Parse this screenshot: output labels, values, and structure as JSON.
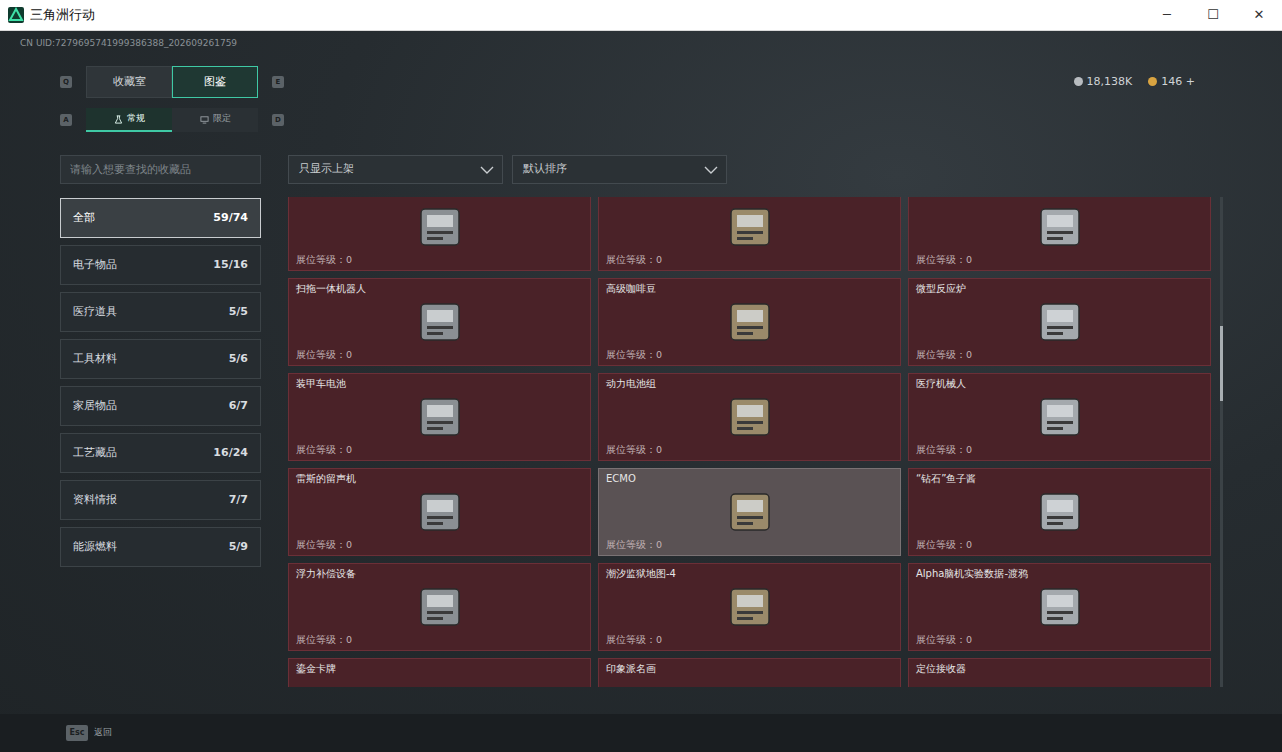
{
  "window": {
    "title": "三角洲行动",
    "controls": [
      "─",
      "☐",
      "✕"
    ]
  },
  "uid": "CN UID:7279695741999386388_202609261759",
  "tab_keys": {
    "left": "Q",
    "right": "E"
  },
  "tabs": [
    {
      "label": "收藏室",
      "selected": false
    },
    {
      "label": "图鉴",
      "selected": true
    }
  ],
  "subtab_keys": {
    "left": "A",
    "right": "D"
  },
  "subtabs": [
    {
      "label": "常规",
      "selected": true
    },
    {
      "label": "限定",
      "selected": false
    }
  ],
  "currencies": [
    {
      "amount": "18,138K",
      "color": "#b8bcc0"
    },
    {
      "amount": "146 +",
      "color": "#d9a441"
    }
  ],
  "search": {
    "placeholder": "请输入想要查找的收藏品"
  },
  "filters": [
    {
      "label": "只显示上架"
    },
    {
      "label": "默认排序"
    }
  ],
  "categories": [
    {
      "label": "全部",
      "count": "59/74",
      "selected": true
    },
    {
      "label": "电子物品",
      "count": "15/16",
      "selected": false
    },
    {
      "label": "医疗道具",
      "count": "5/5",
      "selected": false
    },
    {
      "label": "工具材料",
      "count": "5/6",
      "selected": false
    },
    {
      "label": "家居物品",
      "count": "6/7",
      "selected": false
    },
    {
      "label": "工艺藏品",
      "count": "16/24",
      "selected": false
    },
    {
      "label": "资料情报",
      "count": "7/7",
      "selected": false
    },
    {
      "label": "能源燃料",
      "count": "5/9",
      "selected": false
    }
  ],
  "items": [
    {
      "name": "",
      "rank_text": "展位等级：0",
      "selected": false
    },
    {
      "name": "",
      "rank_text": "展位等级：0",
      "selected": false
    },
    {
      "name": "",
      "rank_text": "展位等级：0",
      "selected": false
    },
    {
      "name": "扫拖一体机器人",
      "rank_text": "展位等级：0",
      "selected": false
    },
    {
      "name": "高级咖啡豆",
      "rank_text": "展位等级：0",
      "selected": false
    },
    {
      "name": "微型反应炉",
      "rank_text": "展位等级：0",
      "selected": false
    },
    {
      "name": "装甲车电池",
      "rank_text": "展位等级：0",
      "selected": false
    },
    {
      "name": "动力电池组",
      "rank_text": "展位等级：0",
      "selected": false
    },
    {
      "name": "医疗机械人",
      "rank_text": "展位等级：0",
      "selected": false
    },
    {
      "name": "雷斯的留声机",
      "rank_text": "展位等级：0",
      "selected": false
    },
    {
      "name": "ECMO",
      "rank_text": "展位等级：0",
      "selected": true
    },
    {
      "name": "“钻石”鱼子酱",
      "rank_text": "展位等级：0",
      "selected": false
    },
    {
      "name": "浮力补偿设备",
      "rank_text": "展位等级：0",
      "selected": false
    },
    {
      "name": "潮汐监狱地图-4",
      "rank_text": "展位等级：0",
      "selected": false
    },
    {
      "name": "Alpha脑机实验数据-渡鸦",
      "rank_text": "展位等级：0",
      "selected": false
    },
    {
      "name": "鎏金卡牌",
      "selected": false
    },
    {
      "name": "印象派名画",
      "selected": false
    },
    {
      "name": "定位接收器",
      "selected": false
    }
  ],
  "footer": {
    "key": "Esc",
    "label": "返回"
  }
}
